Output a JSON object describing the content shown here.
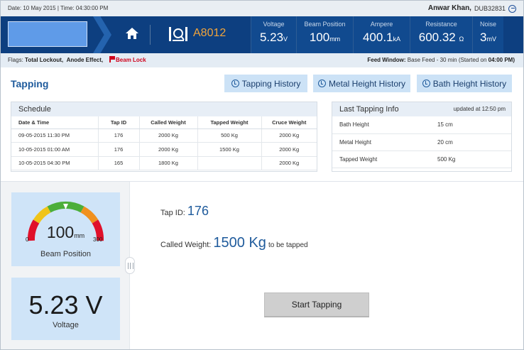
{
  "topbar": {
    "datetime": "Date: 10 May 2015 | Time: 04:30:00 PM",
    "user_name": "Anwar Khan,",
    "user_id": "DUB32831"
  },
  "header": {
    "pot_id": "A8012",
    "metrics": [
      {
        "label": "Voltage",
        "value": "5.23",
        "unit": "V"
      },
      {
        "label": "Beam Position",
        "value": "100",
        "unit": "mm"
      },
      {
        "label": "Ampere",
        "value": "400.1",
        "unit": "kA"
      },
      {
        "label": "Resistance",
        "value": "600.32",
        "unit": "Ω"
      },
      {
        "label": "Noise",
        "value": "3",
        "unit": "mV"
      }
    ]
  },
  "flags": {
    "prefix": "Flags:",
    "total_lockout": "Total Lockout,",
    "anode_effect": "Anode Effect,",
    "beam_lock": "Beam Lock",
    "feed_label": "Feed Window:",
    "feed_value": "Base Feed - 30 min (Started on",
    "feed_time": "04:00 PM)"
  },
  "tapping": {
    "title": "Tapping",
    "buttons": [
      "Tapping History",
      "Metal Height History",
      "Bath Height History"
    ]
  },
  "schedule": {
    "title": "Schedule",
    "columns": [
      "Date & Time",
      "Tap ID",
      "Called Weight",
      "Tapped Weight",
      "Cruce Weight"
    ],
    "rows": [
      [
        "09-05-2015  11:30 PM",
        "176",
        "2000 Kg",
        "500 Kg",
        "2000 Kg"
      ],
      [
        "10-05-2015  01:00 AM",
        "176",
        "2000 Kg",
        "1500 Kg",
        "2000 Kg"
      ],
      [
        "10-05-2015  04:30 PM",
        "165",
        "1800 Kg",
        "",
        "2000 Kg"
      ]
    ]
  },
  "last_tapping": {
    "title": "Last Tapping Info",
    "updated": "updated at 12:50 pm",
    "rows": [
      [
        "Bath Height",
        "15 cm"
      ],
      [
        "Metal Height",
        "20 cm"
      ],
      [
        "Tapped Weight",
        "500 Kg"
      ]
    ]
  },
  "beam_gauge": {
    "value": "100",
    "unit": "mm",
    "min": "0",
    "max": "300",
    "label": "Beam Position",
    "level": 0.33
  },
  "voltage_card": {
    "value": "5.23 V",
    "label": "Voltage"
  },
  "tap_info": {
    "tap_id_label": "Tap ID:",
    "tap_id": "176",
    "called_label": "Called Weight:",
    "called_value": "1500 Kg",
    "called_suffix": "to be tapped"
  },
  "actions": {
    "start_label": "Start Tapping"
  },
  "colors": {
    "header_bg": "#0d3f80",
    "accent": "#1f5b9c",
    "pot_id": "#f2a43a",
    "beam_lock": "#d0021b"
  }
}
